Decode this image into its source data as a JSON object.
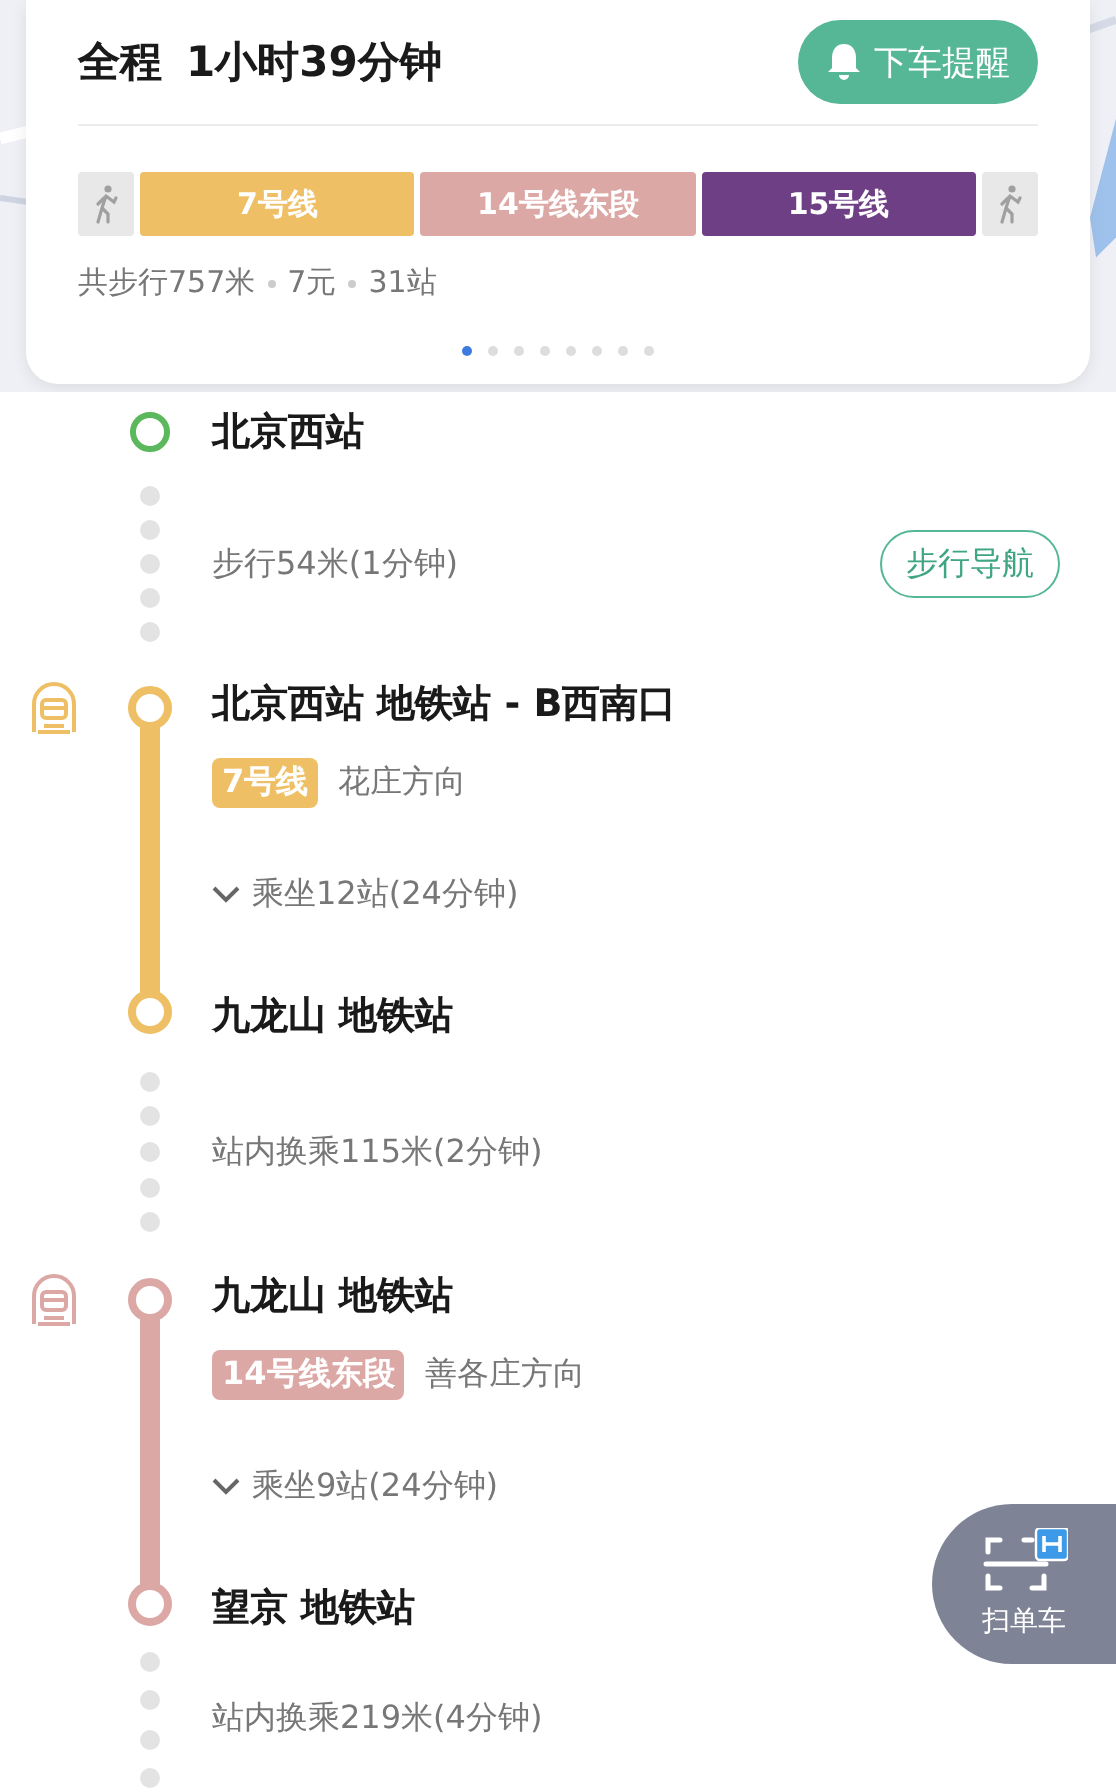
{
  "summary": {
    "label": "全程",
    "duration": "1小时39分钟",
    "alert_button": "下车提醒",
    "segments": [
      {
        "kind": "walk"
      },
      {
        "kind": "line",
        "label": "7号线",
        "color": "#efbf66"
      },
      {
        "kind": "line",
        "label": "14号线东段",
        "color": "#dca8a5"
      },
      {
        "kind": "line",
        "label": "15号线",
        "color": "#6f3f86"
      },
      {
        "kind": "walk"
      }
    ],
    "stats": [
      "共步行757米",
      "7元",
      "31站"
    ],
    "pager": [
      {
        "selected": true
      },
      {
        "selected": false
      },
      {
        "selected": false
      },
      {
        "selected": false
      },
      {
        "selected": false
      },
      {
        "selected": false
      },
      {
        "selected": false
      },
      {
        "selected": false
      }
    ]
  },
  "route": [
    {
      "kind": "start",
      "name": "北京西站"
    },
    {
      "kind": "walk",
      "text": "步行54米(1分钟)",
      "button": "步行导航"
    },
    {
      "kind": "ride",
      "color": "#efbf66",
      "from": "北京西站 地铁站 - B西南口",
      "line": "7号线",
      "direction": "花庄方向",
      "stops": "乘坐12站(24分钟)",
      "to": "九龙山 地铁站"
    },
    {
      "kind": "transfer",
      "text": "站内换乘115米(2分钟)"
    },
    {
      "kind": "ride",
      "color": "#dca8a5",
      "from": "九龙山 地铁站",
      "line": "14号线东段",
      "direction": "善各庄方向",
      "stops": "乘坐9站(24分钟)",
      "to": "望京 地铁站"
    },
    {
      "kind": "transfer",
      "text": "站内换乘219米(4分钟)"
    }
  ],
  "scan_button": "扫单车"
}
